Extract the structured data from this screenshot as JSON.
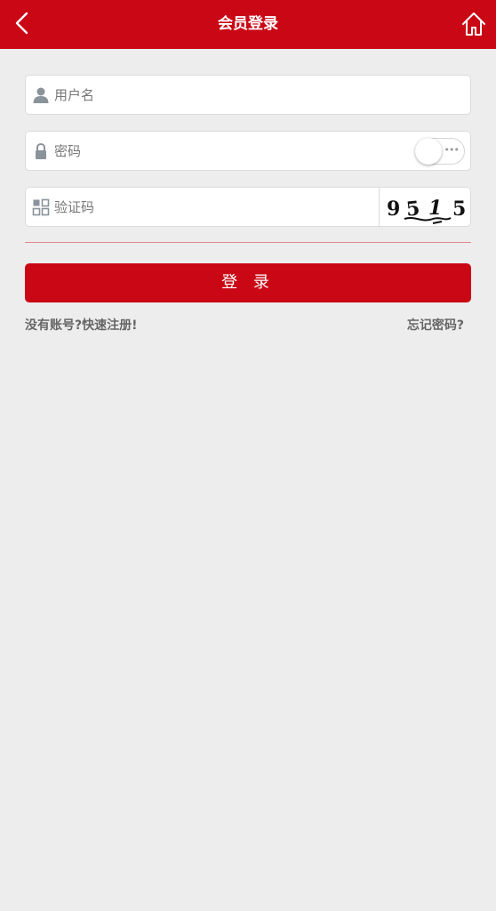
{
  "header": {
    "title": "会员登录",
    "back_icon": "chevron-left-icon",
    "home_icon": "home-icon",
    "background": "#ca0815"
  },
  "form": {
    "username": {
      "placeholder": "用户名",
      "value": "",
      "icon": "user-icon"
    },
    "password": {
      "placeholder": "密码",
      "value": "",
      "icon": "lock-icon",
      "show_password": false
    },
    "captcha": {
      "placeholder": "验证码",
      "value": "",
      "icon": "grid-icon",
      "image_text": "9515"
    },
    "login_label": "登 录"
  },
  "links": {
    "register": "没有账号?快速注册!",
    "forgot": "忘记密码?"
  },
  "colors": {
    "accent": "#ca0815",
    "background": "#ededed",
    "link_text": "#666666"
  }
}
